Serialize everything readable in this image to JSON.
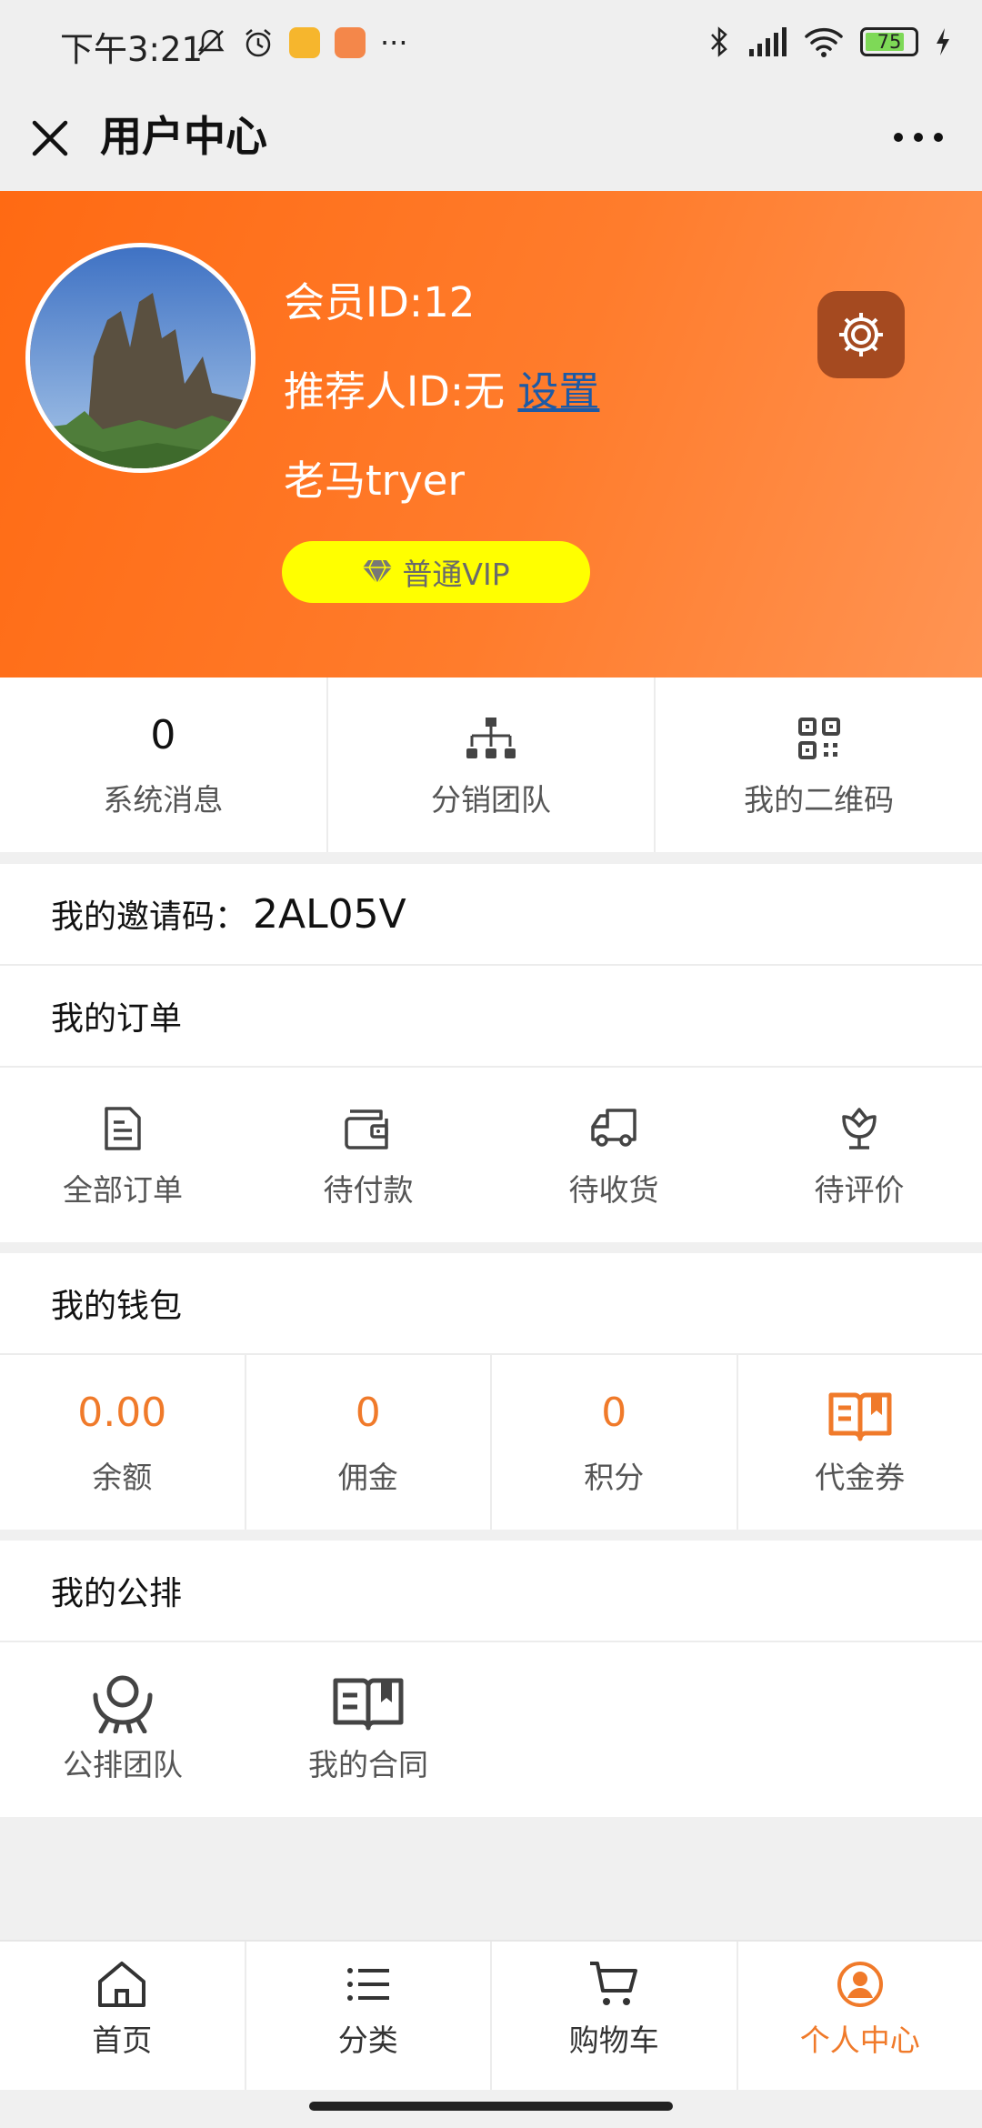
{
  "status_bar": {
    "time": "下午3:21",
    "battery": "75",
    "more": "···"
  },
  "nav": {
    "title": "用户中心"
  },
  "profile": {
    "member_id": "会员ID:12",
    "referrer_prefix": "推荐人ID:无",
    "referrer_link": "设置",
    "nickname": "老马tryer",
    "vip_label": "普通VIP"
  },
  "shortcuts": [
    {
      "value": "0",
      "label": "系统消息"
    },
    {
      "icon": "org-chart-icon",
      "label": "分销团队"
    },
    {
      "icon": "qr-code-icon",
      "label": "我的二维码"
    }
  ],
  "invite": {
    "label": "我的邀请码：",
    "code": "2AL05V"
  },
  "orders": {
    "title": "我的订单",
    "items": [
      {
        "icon": "document-icon",
        "label": "全部订单"
      },
      {
        "icon": "wallet-icon",
        "label": "待付款"
      },
      {
        "icon": "truck-icon",
        "label": "待收货"
      },
      {
        "icon": "flower-icon",
        "label": "待评价"
      }
    ]
  },
  "wallet": {
    "title": "我的钱包",
    "items": [
      {
        "value": "0.00",
        "label": "余额"
      },
      {
        "value": "0",
        "label": "佣金"
      },
      {
        "value": "0",
        "label": "积分"
      },
      {
        "icon": "open-book-icon",
        "label": "代金券"
      }
    ]
  },
  "public": {
    "title": "我的公排",
    "items": [
      {
        "icon": "team-hands-icon",
        "label": "公排团队"
      },
      {
        "icon": "contract-book-icon",
        "label": "我的合同"
      }
    ]
  },
  "tabbar": [
    {
      "icon": "home-icon",
      "label": "首页"
    },
    {
      "icon": "list-icon",
      "label": "分类"
    },
    {
      "icon": "cart-icon",
      "label": "购物车"
    },
    {
      "icon": "user-circle-icon",
      "label": "个人中心",
      "active": true
    }
  ],
  "colors": {
    "accent": "#f07a2a",
    "header_start": "#ff6a13",
    "header_end": "#ff9453",
    "vip_bg": "#ffff00"
  }
}
